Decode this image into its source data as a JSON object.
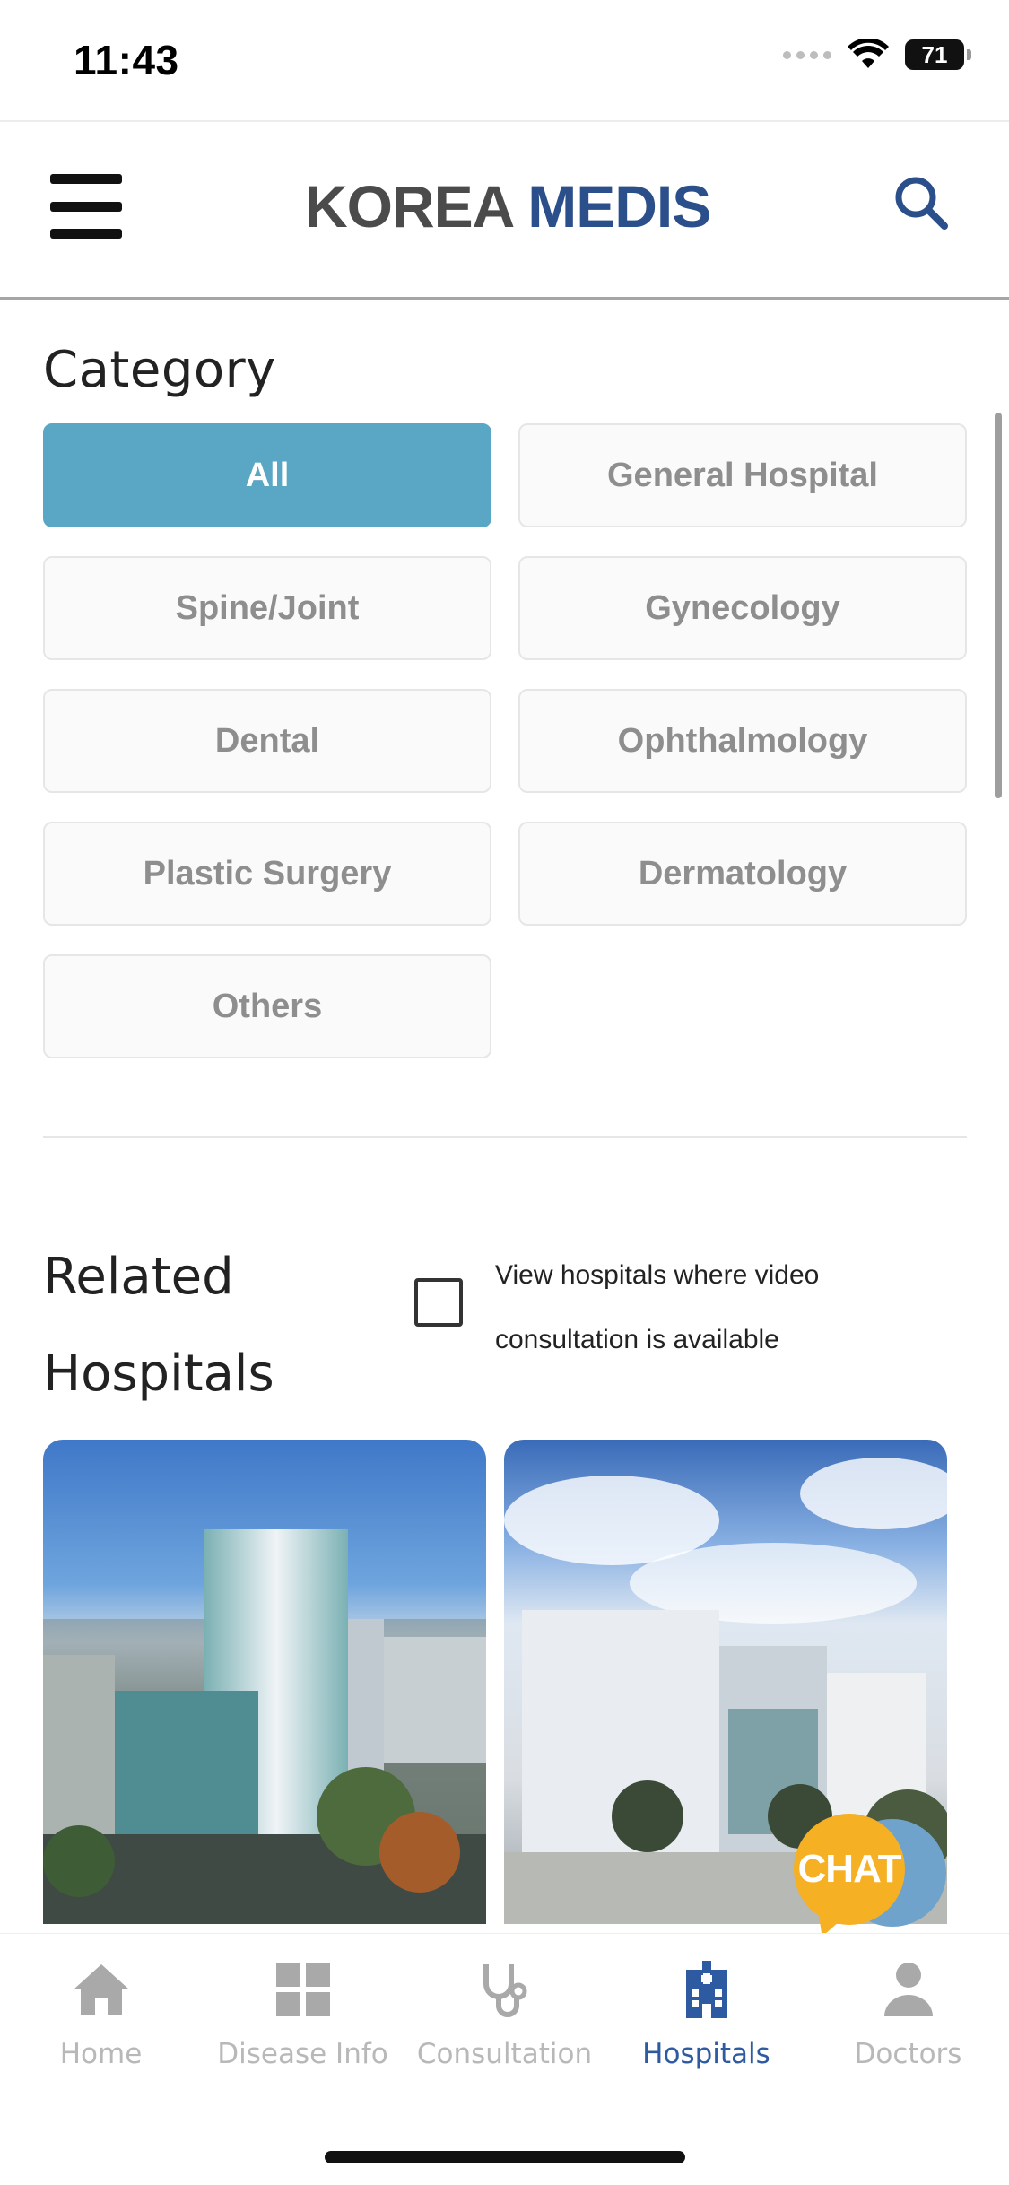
{
  "status_bar": {
    "time": "11:43",
    "battery": "71"
  },
  "header": {
    "logo_part1": "KOREA",
    "logo_part2": "MEDIS"
  },
  "category": {
    "title": "Category",
    "items": [
      {
        "label": "All",
        "active": true
      },
      {
        "label": "General Hospital",
        "active": false
      },
      {
        "label": "Spine/Joint",
        "active": false
      },
      {
        "label": "Gynecology",
        "active": false
      },
      {
        "label": "Dental",
        "active": false
      },
      {
        "label": "Ophthalmology",
        "active": false
      },
      {
        "label": "Plastic Surgery",
        "active": false
      },
      {
        "label": "Dermatology",
        "active": false
      },
      {
        "label": "Others",
        "active": false
      }
    ]
  },
  "related": {
    "title": "Related Hospitals",
    "video_filter_label": "View hospitals where video consultation is available",
    "video_filter_checked": false
  },
  "chat": {
    "label": "CHAT"
  },
  "tabs": [
    {
      "label": "Home",
      "icon": "home-icon",
      "active": false
    },
    {
      "label": "Disease Info",
      "icon": "grid-icon",
      "active": false
    },
    {
      "label": "Consultation",
      "icon": "stethoscope-icon",
      "active": false
    },
    {
      "label": "Hospitals",
      "icon": "hospital-icon",
      "active": true
    },
    {
      "label": "Doctors",
      "icon": "person-icon",
      "active": false
    }
  ],
  "colors": {
    "accent": "#5aa7c5",
    "active_tab": "#2d5aa0",
    "chat": "#f6b024"
  }
}
